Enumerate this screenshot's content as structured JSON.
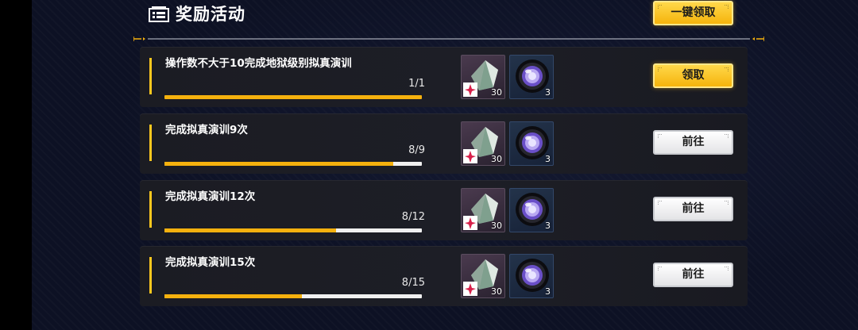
{
  "header": {
    "title": "奖励活动",
    "claim_all_label": "一键领取"
  },
  "tasks": [
    {
      "name": "操作数不大于10完成地狱级别拟真演训",
      "progress_text": "1/1",
      "progress": 1.0,
      "rewards": [
        {
          "icon": "crystal-icon",
          "count": "30"
        },
        {
          "icon": "lens-icon",
          "count": "3"
        }
      ],
      "button_label": "领取",
      "button_style": "gold"
    },
    {
      "name": "完成拟真演训9次",
      "progress_text": "8/9",
      "progress": 0.889,
      "rewards": [
        {
          "icon": "crystal-icon",
          "count": "30"
        },
        {
          "icon": "lens-icon",
          "count": "3"
        }
      ],
      "button_label": "前往",
      "button_style": "white"
    },
    {
      "name": "完成拟真演训12次",
      "progress_text": "8/12",
      "progress": 0.667,
      "rewards": [
        {
          "icon": "crystal-icon",
          "count": "30"
        },
        {
          "icon": "lens-icon",
          "count": "3"
        }
      ],
      "button_label": "前往",
      "button_style": "white"
    },
    {
      "name": "完成拟真演训15次",
      "progress_text": "8/15",
      "progress": 0.533,
      "rewards": [
        {
          "icon": "crystal-icon",
          "count": "30"
        },
        {
          "icon": "lens-icon",
          "count": "3"
        }
      ],
      "button_label": "前往",
      "button_style": "white"
    }
  ],
  "colors": {
    "accent_gold": "#f5b10e",
    "track_white": "#f0f0f0",
    "row_bg": "#1c1d25"
  }
}
